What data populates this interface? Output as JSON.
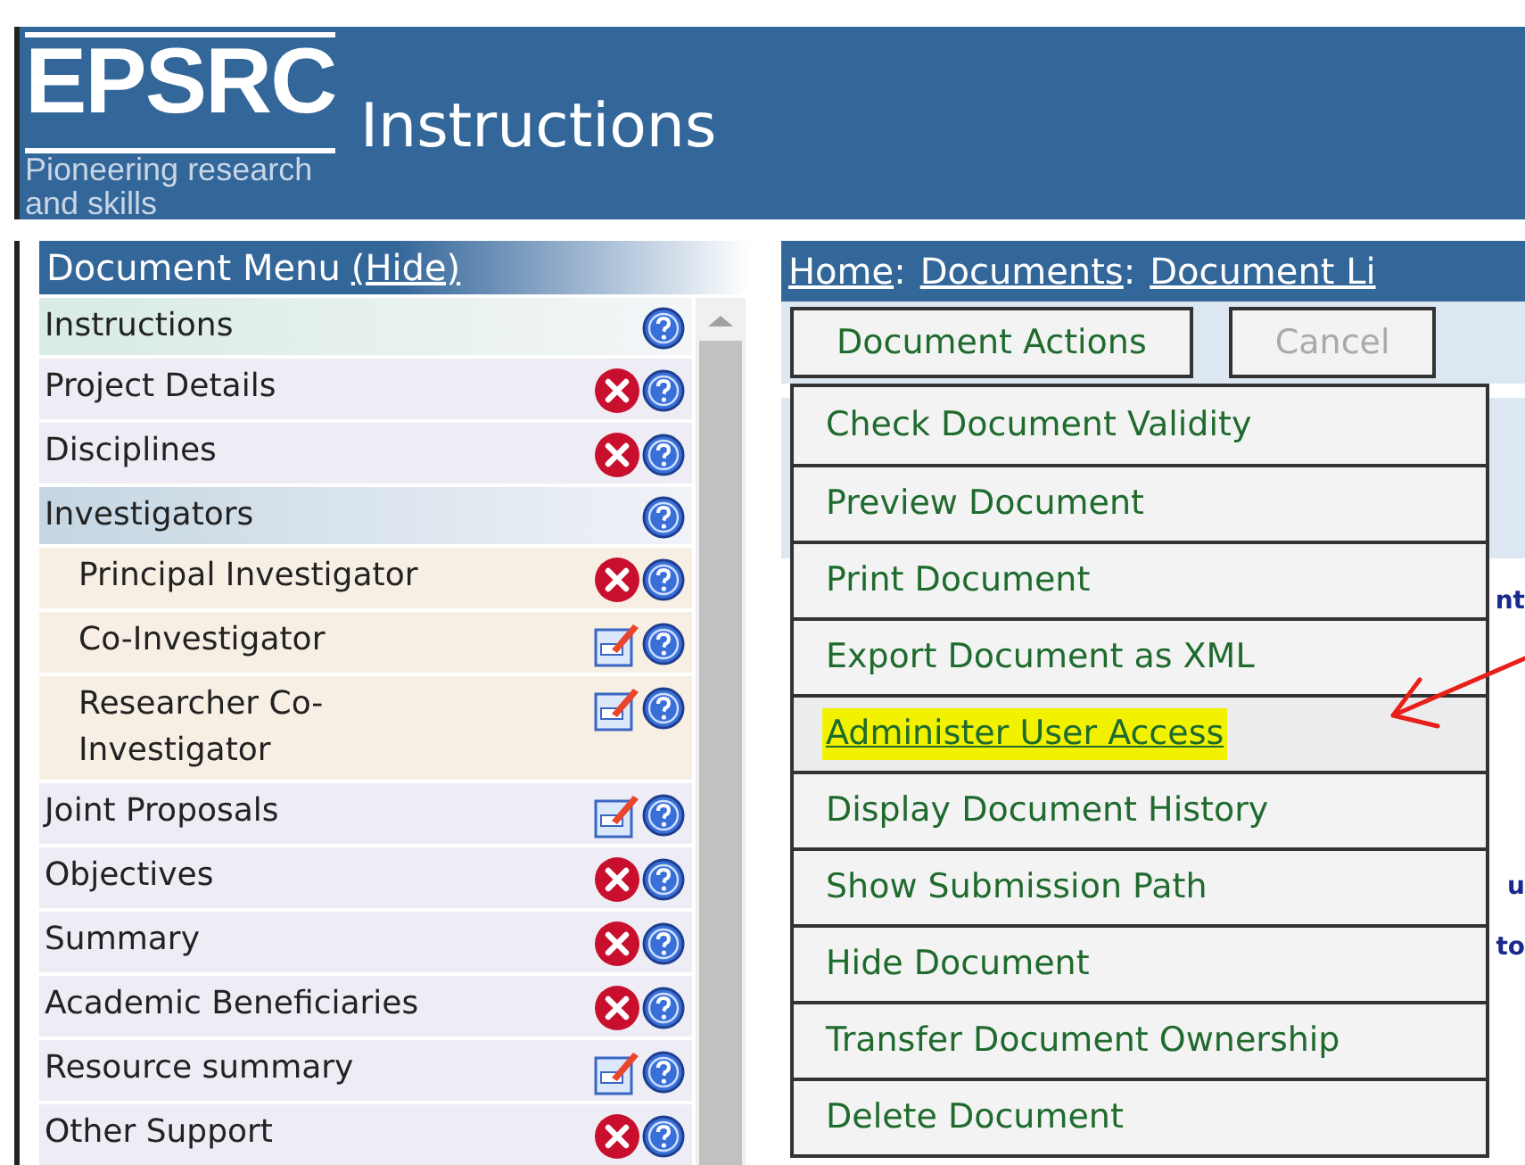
{
  "header": {
    "logo": "EPSRC",
    "tagline": "Pioneering research and skills",
    "title": "Instructions"
  },
  "sidebar": {
    "title": "Document Menu",
    "hide_link": "(Hide)",
    "items": [
      {
        "label": "Instructions",
        "kind": "none",
        "selected": true
      },
      {
        "label": "Project Details",
        "kind": "error",
        "selected": false
      },
      {
        "label": "Disciplines",
        "kind": "error",
        "selected": false
      },
      {
        "label": "Investigators",
        "kind": "none",
        "selected": false,
        "children": [
          {
            "label": "Principal Investigator",
            "kind": "error",
            "selected": false
          },
          {
            "label": "Co-Investigator",
            "kind": "edit",
            "selected": false
          },
          {
            "label": "Researcher Co-Investigator",
            "kind": "edit",
            "selected": false
          }
        ]
      },
      {
        "label": "Joint Proposals",
        "kind": "edit",
        "selected": false
      },
      {
        "label": "Objectives",
        "kind": "error",
        "selected": false
      },
      {
        "label": "Summary",
        "kind": "error",
        "selected": false
      },
      {
        "label": "Academic Beneficiaries",
        "kind": "error",
        "selected": false
      },
      {
        "label": "Resource summary",
        "kind": "edit",
        "selected": false
      },
      {
        "label": "Other Support",
        "kind": "error",
        "selected": false
      }
    ]
  },
  "breadcrumb": {
    "separator": ":",
    "items": [
      "Home",
      "Documents",
      "Document Li"
    ]
  },
  "toolbar": [
    {
      "label": "Document Actions",
      "disabled": false
    },
    {
      "label": "Cancel",
      "disabled": true
    }
  ],
  "actions_menu": [
    {
      "label": "Check Document Validity",
      "selected": false
    },
    {
      "label": "Preview Document",
      "selected": false
    },
    {
      "label": "Print Document",
      "selected": false
    },
    {
      "label": "Export Document as XML",
      "selected": false
    },
    {
      "label": "Administer User Access",
      "selected": true
    },
    {
      "label": "Display Document History",
      "selected": false
    },
    {
      "label": "Show Submission Path",
      "selected": false
    },
    {
      "label": "Hide Document",
      "selected": false
    },
    {
      "label": "Transfer Document Ownership",
      "selected": false
    },
    {
      "label": "Delete Document",
      "selected": false
    }
  ],
  "content_fragments": [
    "nt",
    "u",
    "to"
  ]
}
